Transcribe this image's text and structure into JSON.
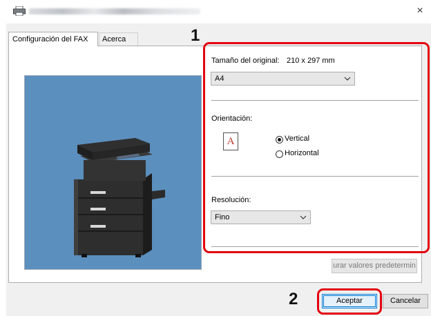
{
  "window": {
    "title": "",
    "close_glyph": "×"
  },
  "tabs": [
    {
      "label": "Configuración del FAX",
      "active": true
    },
    {
      "label": "Acerca de",
      "active": false
    }
  ],
  "original_size": {
    "label": "Tamaño del original:",
    "dimensions": "210 x 297 mm",
    "selected": "A4"
  },
  "orientation": {
    "label": "Orientación:",
    "icon_letter": "A",
    "options": [
      {
        "label": "Vertical",
        "checked": true
      },
      {
        "label": "Horizontal",
        "checked": false
      }
    ]
  },
  "resolution": {
    "label": "Resolución:",
    "selected": "Fino"
  },
  "buttons": {
    "restore_defaults": "urar valores predetermin",
    "ok": "Aceptar",
    "cancel": "Cancelar"
  },
  "callouts": [
    "1",
    "2"
  ],
  "colors": {
    "callout_red": "#e3000f",
    "preview_bg": "#5b8fbe",
    "accent_blue": "#0078d7"
  }
}
